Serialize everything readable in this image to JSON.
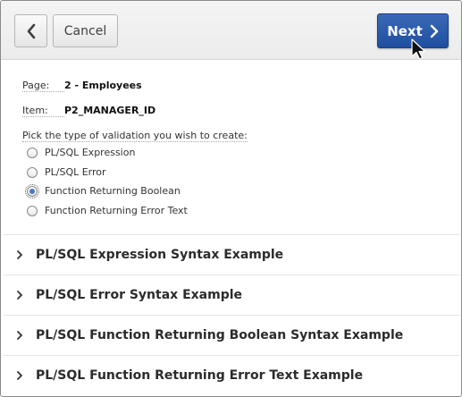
{
  "toolbar": {
    "back_icon": "chevron-left-icon",
    "cancel_label": "Cancel",
    "next_label": "Next",
    "next_icon": "chevron-right-icon"
  },
  "fields": {
    "page_label": "Page:",
    "page_value": "2 - Employees",
    "item_label": "Item:",
    "item_value": "P2_MANAGER_ID"
  },
  "validation": {
    "prompt": "Pick the type of validation you wish to create:",
    "options": [
      {
        "label": "PL/SQL Expression",
        "checked": false
      },
      {
        "label": "PL/SQL Error",
        "checked": false
      },
      {
        "label": "Function Returning Boolean",
        "checked": true
      },
      {
        "label": "Function Returning Error Text",
        "checked": false
      }
    ]
  },
  "examples": [
    {
      "title": "PL/SQL Expression Syntax Example"
    },
    {
      "title": "PL/SQL Error Syntax Example"
    },
    {
      "title": "PL/SQL Function Returning Boolean Syntax Example"
    },
    {
      "title": "PL/SQL Function Returning Error Text Example"
    }
  ],
  "colors": {
    "primary": "#2a5aab",
    "radio_selected": "#4a78c2"
  }
}
